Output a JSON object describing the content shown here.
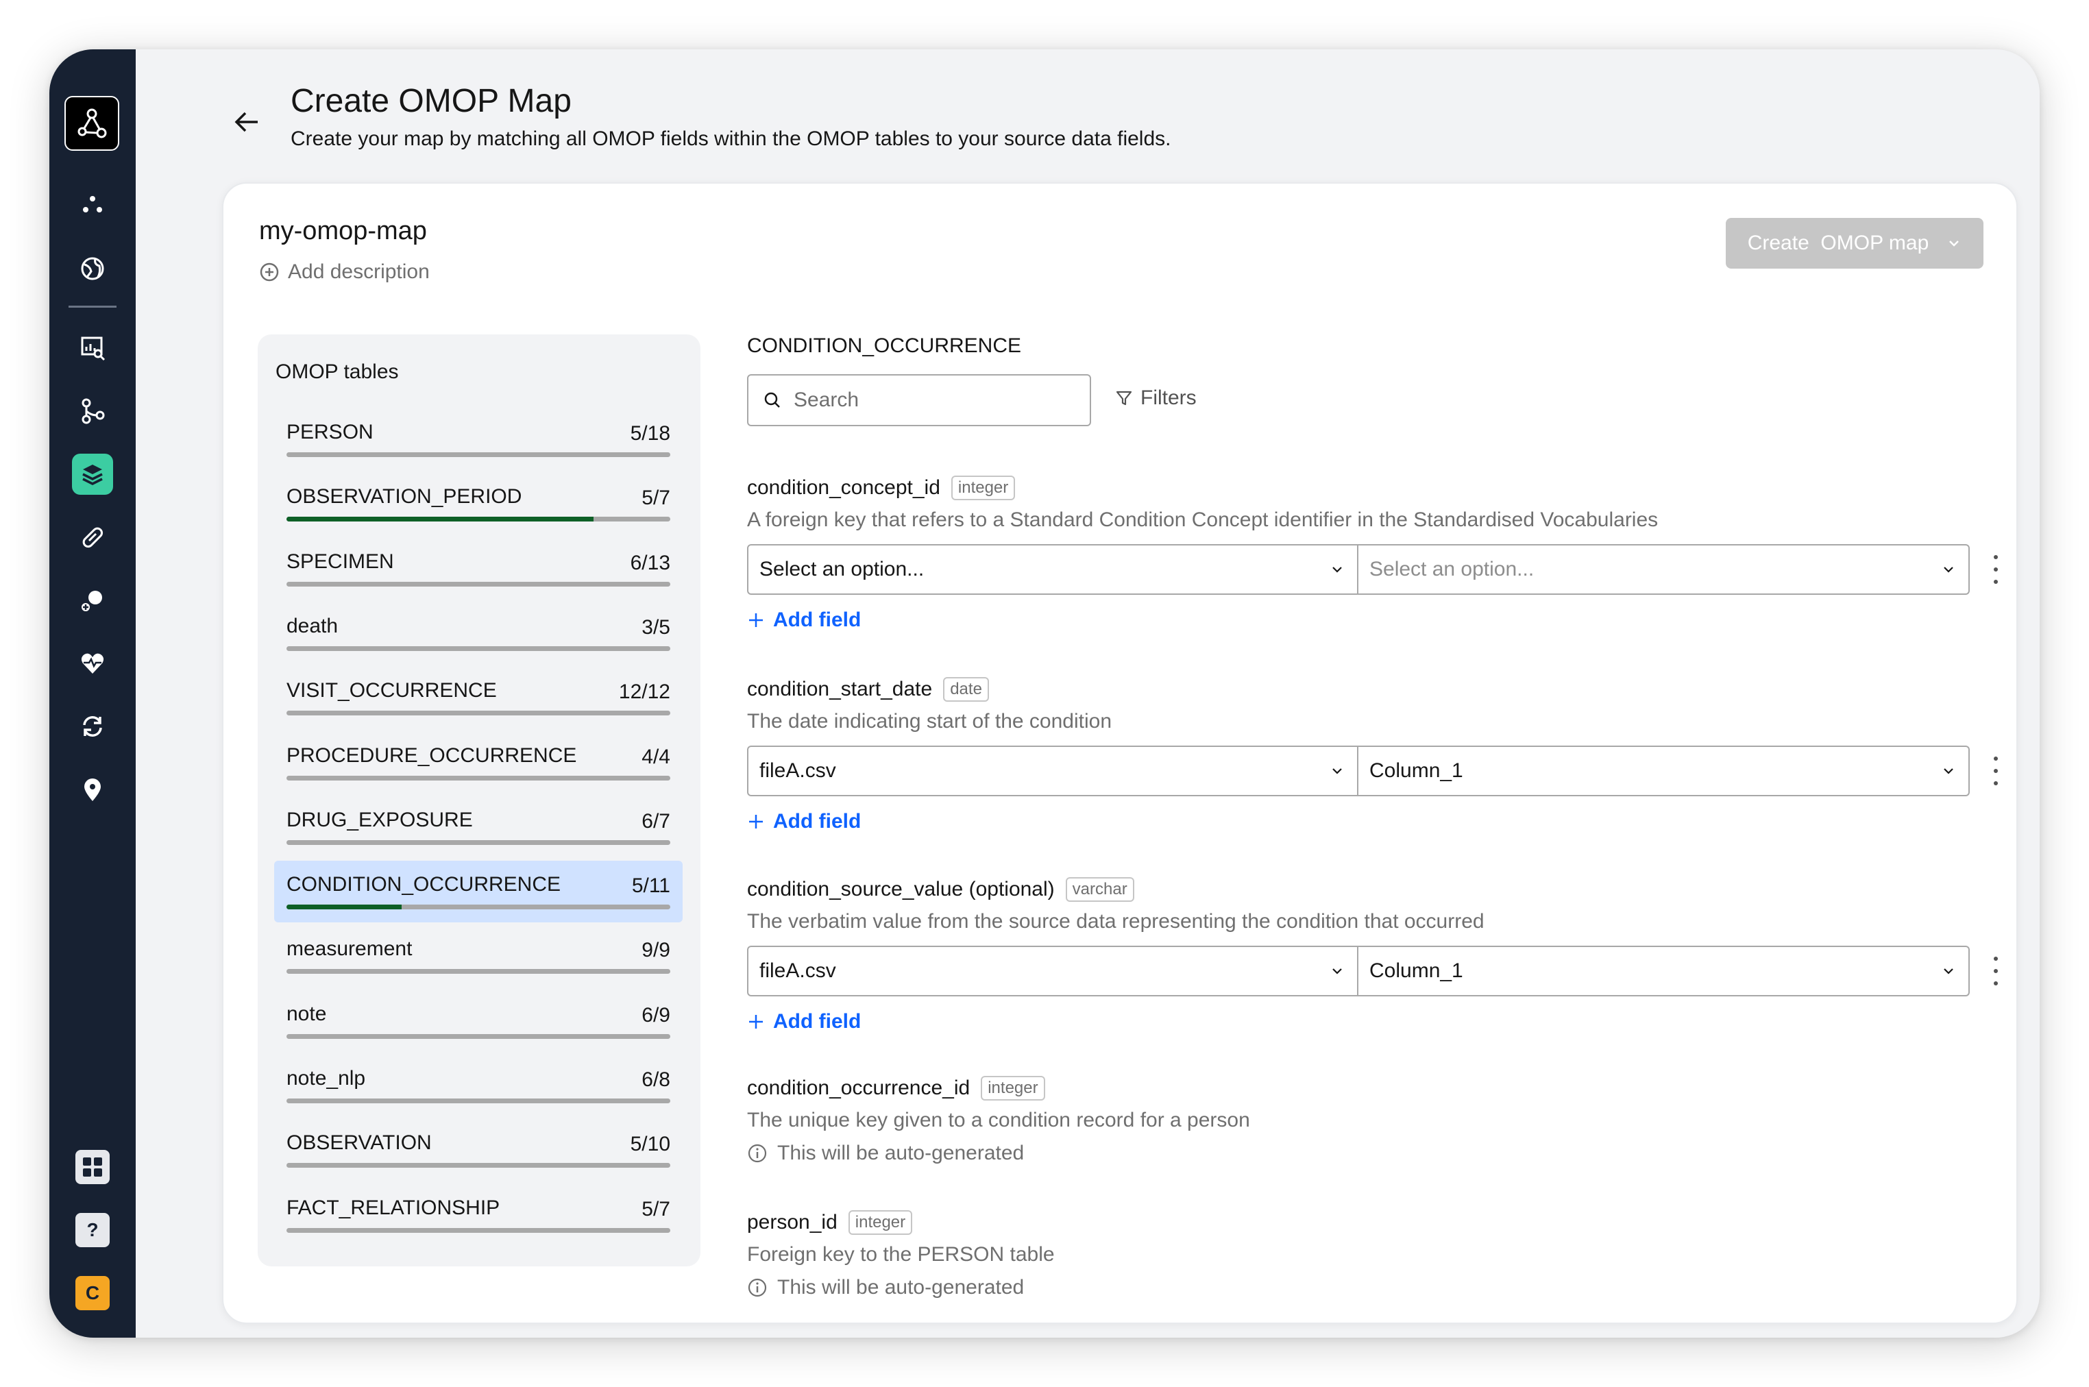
{
  "page": {
    "title": "Create OMOP Map",
    "subtitle": "Create your map by matching all OMOP fields within the OMOP tables to your source data fields."
  },
  "card": {
    "map_name": "my-omop-map",
    "add_description": "Add description",
    "create_button": "Create  OMOP map"
  },
  "sidebar": {
    "apps_icon": "grid-icon",
    "help_label": "?",
    "user_initial": "C",
    "active_color": "#3ccda2"
  },
  "tables_panel": {
    "title": "OMOP tables",
    "items": [
      {
        "name": "PERSON",
        "count": "5/18",
        "progress": 0
      },
      {
        "name": "OBSERVATION_PERIOD",
        "count": "5/7",
        "progress": 0.8
      },
      {
        "name": "SPECIMEN",
        "count": "6/13",
        "progress": 0
      },
      {
        "name": "death",
        "count": "3/5",
        "progress": 0
      },
      {
        "name": "VISIT_OCCURRENCE",
        "count": "12/12",
        "progress": 0
      },
      {
        "name": "PROCEDURE_OCCURRENCE",
        "count": "4/4",
        "progress": 0
      },
      {
        "name": "DRUG_EXPOSURE",
        "count": "6/7",
        "progress": 0
      },
      {
        "name": "CONDITION_OCCURRENCE",
        "count": "5/11",
        "progress": 0.3,
        "selected": true
      },
      {
        "name": "measurement",
        "count": "9/9",
        "progress": 0
      },
      {
        "name": "note",
        "count": "6/9",
        "progress": 0
      },
      {
        "name": "note_nlp",
        "count": "6/8",
        "progress": 0
      },
      {
        "name": "OBSERVATION",
        "count": "5/10",
        "progress": 0
      },
      {
        "name": "FACT_RELATIONSHIP",
        "count": "5/7",
        "progress": 0
      }
    ]
  },
  "detail": {
    "section_title": "CONDITION_OCCURRENCE",
    "search_placeholder": "Search",
    "filters_label": "Filters",
    "fields": [
      {
        "name": "condition_concept_id",
        "type": "integer",
        "description": "A foreign key that refers to a Standard Condition Concept identifier in the Standardised Vocabularies",
        "left_value": "Select an option...",
        "right_value": "Select an option...",
        "add_field": "Add field"
      },
      {
        "name": "condition_start_date",
        "type": "date",
        "description": "The date indicating start of the condition",
        "left_value": "fileA.csv",
        "right_value": "Column_1",
        "add_field": "Add field"
      },
      {
        "name": "condition_source_value",
        "optional": "(optional)",
        "type": "varchar",
        "description": "The verbatim value from the source data representing the condition that occurred",
        "left_value": "fileA.csv",
        "right_value": "Column_1",
        "add_field": "Add field"
      },
      {
        "name": "condition_occurrence_id",
        "type": "integer",
        "description": "The unique key given to a condition record for a person",
        "auto_generated": "This will be auto-generated"
      },
      {
        "name": "person_id",
        "type": "integer",
        "description": "Foreign key to the PERSON table",
        "auto_generated": "This will be auto-generated"
      }
    ]
  }
}
